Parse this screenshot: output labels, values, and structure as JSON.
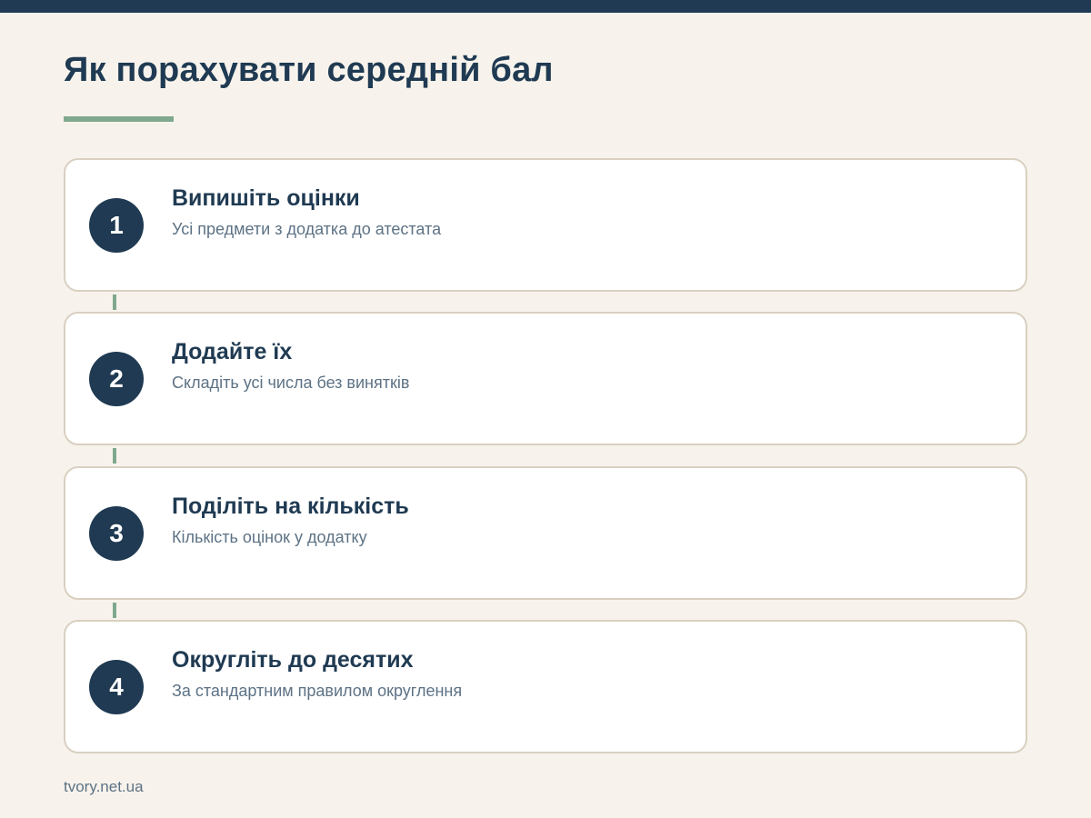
{
  "title": "Як порахувати середній бал",
  "colors": {
    "primary": "#1f3a52",
    "accent": "#7fa88e",
    "background": "#f7f3ec",
    "card_border": "#d9d0c1",
    "muted_text": "#5d7285"
  },
  "steps": [
    {
      "number": "1",
      "title": "Випишіть оцінки",
      "description": "Усі предмети з додатка до атестата"
    },
    {
      "number": "2",
      "title": "Додайте їх",
      "description": "Складіть усі числа без винятків"
    },
    {
      "number": "3",
      "title": "Поділіть на кількість",
      "description": "Кількість оцінок у додатку"
    },
    {
      "number": "4",
      "title": "Округліть до десятих",
      "description": "За стандартним правилом округлення"
    }
  ],
  "footer": "tvory.net.ua"
}
